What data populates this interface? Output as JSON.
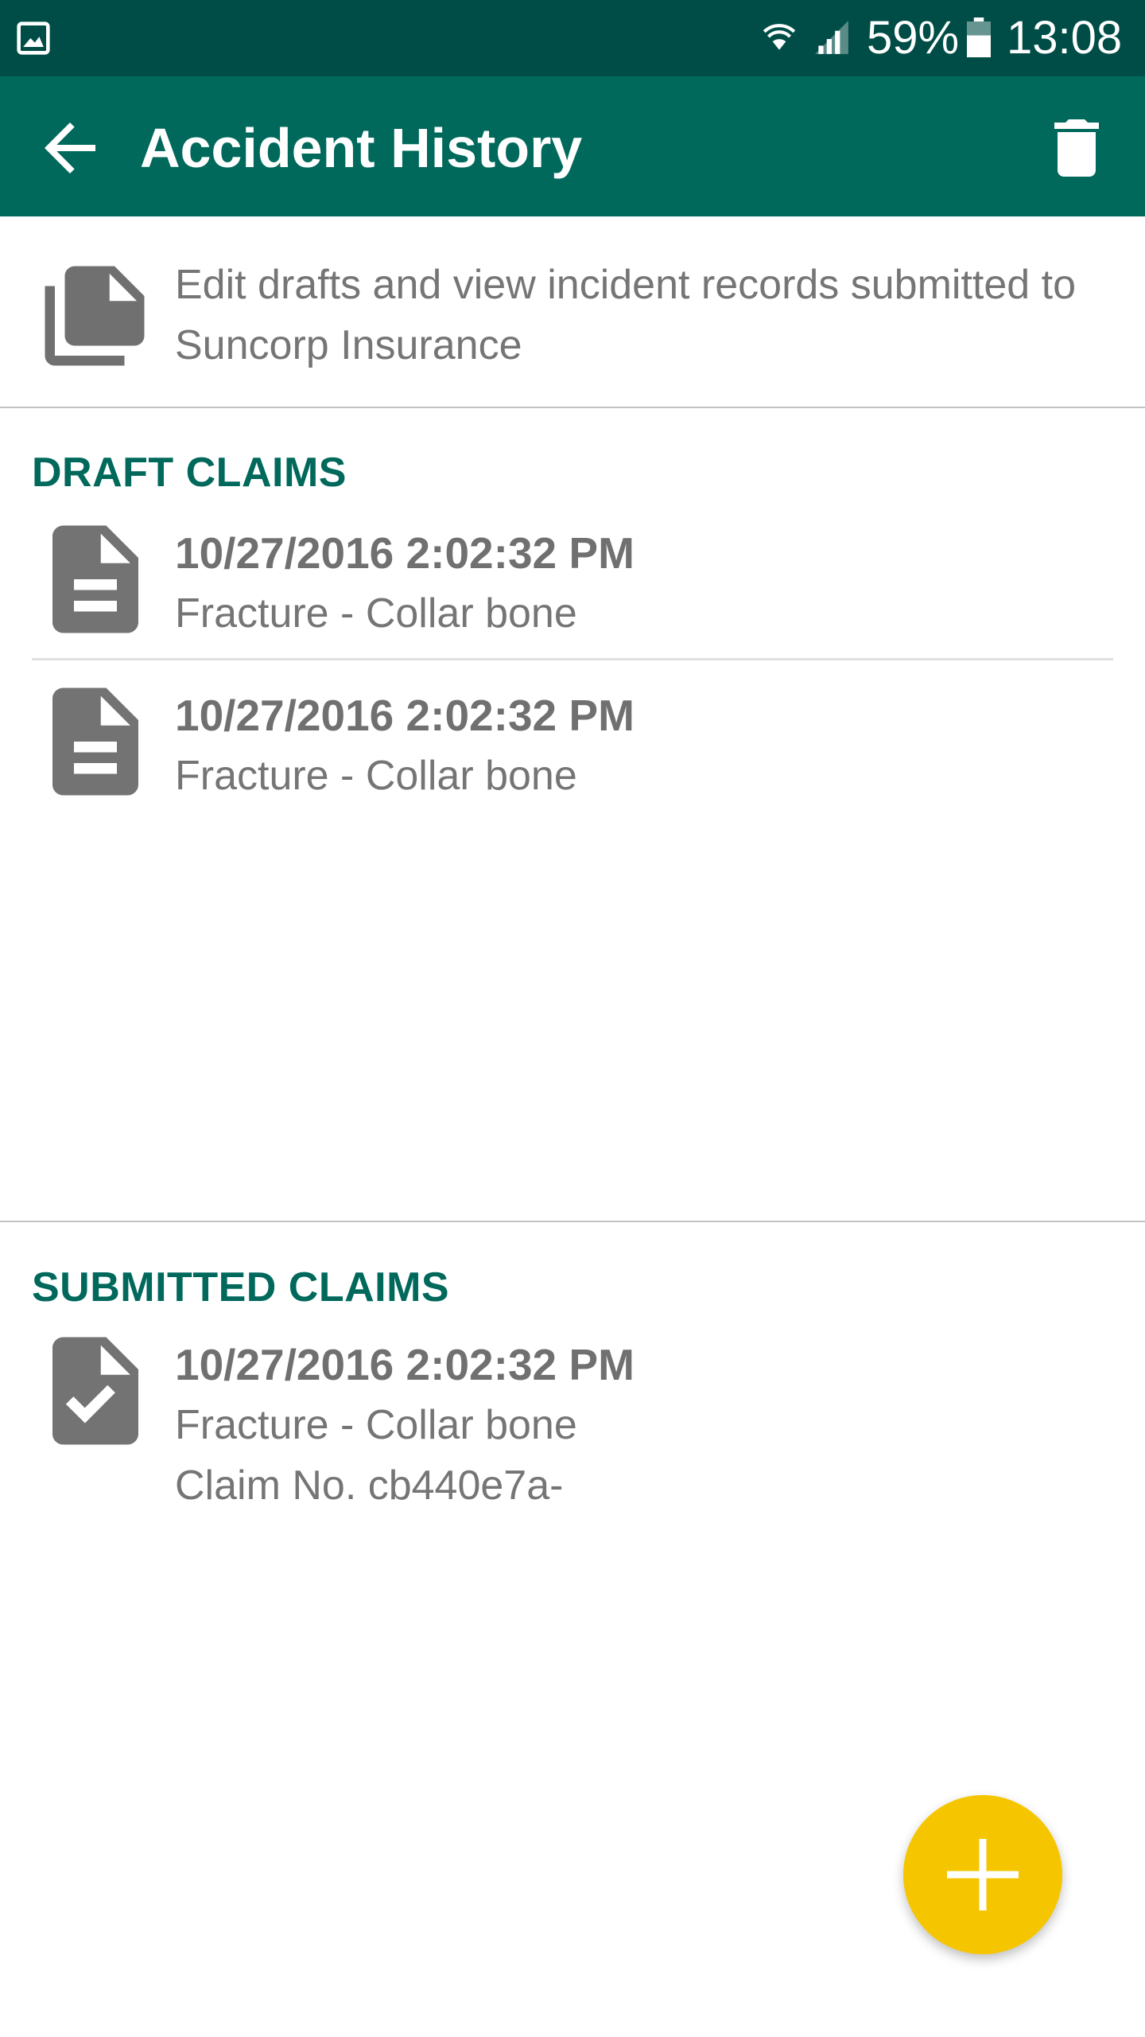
{
  "status_bar": {
    "battery_percent": "59%",
    "time": "13:08",
    "icons": [
      "image-icon",
      "wifi-icon",
      "signal-icon",
      "battery-icon"
    ]
  },
  "app_bar": {
    "title": "Accident History",
    "back_icon": "arrow-back-icon",
    "delete_icon": "trash-icon",
    "color": "#00695c"
  },
  "intro": {
    "icon": "documents-icon",
    "text": "Edit drafts and view incident records submitted to Suncorp Insurance"
  },
  "draft_claims": {
    "header": "DRAFT CLAIMS",
    "items": [
      {
        "icon": "document-icon",
        "date": "10/27/2016 2:02:32 PM",
        "description": "Fracture - Collar bone"
      },
      {
        "icon": "document-icon",
        "date": "10/27/2016 2:02:32 PM",
        "description": "Fracture - Collar bone"
      }
    ]
  },
  "submitted_claims": {
    "header": "SUBMITTED CLAIMS",
    "items": [
      {
        "icon": "document-check-icon",
        "date": "10/27/2016 2:02:32 PM",
        "description": "Fracture - Collar bone",
        "claim_no": "Claim No. cb440e7a-"
      }
    ]
  },
  "fab": {
    "icon": "plus-icon",
    "color": "#f5c600"
  }
}
